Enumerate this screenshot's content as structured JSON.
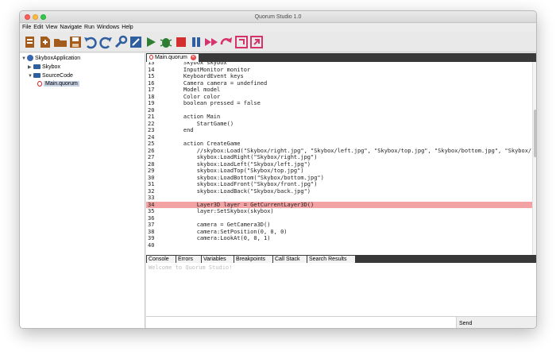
{
  "window": {
    "title": "Quorum Studio 1.0"
  },
  "menu": [
    "File",
    "Edit",
    "View",
    "Navigate",
    "Run",
    "Windows",
    "Help"
  ],
  "toolbar_icons": [
    "new-project-icon",
    "new-file-icon",
    "open-icon",
    "save-icon",
    "undo-icon",
    "redo-icon",
    "build-icon",
    "clean-build-icon",
    "run-icon",
    "debug-icon",
    "stop-icon",
    "pause-icon",
    "continue-icon",
    "step-over-icon",
    "step-into-icon",
    "step-out-icon"
  ],
  "tree": {
    "project": "SkyboxApplication",
    "folder1": "Skybox",
    "folder2": "SourceCode",
    "file": "Main.quorum"
  },
  "editor": {
    "tab": "Main.quorum",
    "lines": [
      {
        "n": "13",
        "t": "    Skybox skybox"
      },
      {
        "n": "14",
        "t": "    InputMonitor monitor"
      },
      {
        "n": "15",
        "t": "    KeyboardEvent keys"
      },
      {
        "n": "16",
        "t": "    Camera camera = undefined"
      },
      {
        "n": "17",
        "t": "    Model model"
      },
      {
        "n": "18",
        "t": "    Color color"
      },
      {
        "n": "19",
        "t": "    boolean pressed = false"
      },
      {
        "n": "20",
        "t": ""
      },
      {
        "n": "21",
        "t": "    action Main"
      },
      {
        "n": "22",
        "t": "        StartGame()"
      },
      {
        "n": "23",
        "t": "    end"
      },
      {
        "n": "24",
        "t": ""
      },
      {
        "n": "25",
        "t": "    action CreateGame"
      },
      {
        "n": "26",
        "t": "        //skybox:Load(\"Skybox/right.jpg\", \"Skybox/left.jpg\", \"Skybox/top.jpg\", \"Skybox/bottom.jpg\", \"Skybox/"
      },
      {
        "n": "27",
        "t": "        skybox:LoadRight(\"Skybox/right.jpg\")"
      },
      {
        "n": "28",
        "t": "        skybox:LoadLeft(\"Skybox/left.jpg\")"
      },
      {
        "n": "29",
        "t": "        skybox:LoadTop(\"Skybox/top.jpg\")"
      },
      {
        "n": "30",
        "t": "        skybox:LoadBottom(\"Skybox/bottom.jpg\")"
      },
      {
        "n": "31",
        "t": "        skybox:LoadFront(\"Skybox/front.jpg\")"
      },
      {
        "n": "32",
        "t": "        skybox:LoadBack(\"Skybox/back.jpg\")"
      },
      {
        "n": "33",
        "t": ""
      },
      {
        "n": "34",
        "t": "        Layer3D layer = GetCurrentLayer3D()"
      },
      {
        "n": "35",
        "t": "        layer:SetSkybox(skybox)"
      },
      {
        "n": "36",
        "t": ""
      },
      {
        "n": "37",
        "t": "        camera = GetCamera3D()"
      },
      {
        "n": "38",
        "t": "        camera:SetPosition(0, 0, 0)"
      },
      {
        "n": "39",
        "t": "        camera:LookAt(0, 0, 1)"
      },
      {
        "n": "40",
        "t": ""
      }
    ],
    "highlight_line": "34"
  },
  "bottom_tabs": [
    "Console",
    "Errors",
    "Variables",
    "Breakpoints",
    "Call Stack",
    "Search Results"
  ],
  "console": {
    "text": "Welcome to Quorum Studio!"
  },
  "send": "Send"
}
